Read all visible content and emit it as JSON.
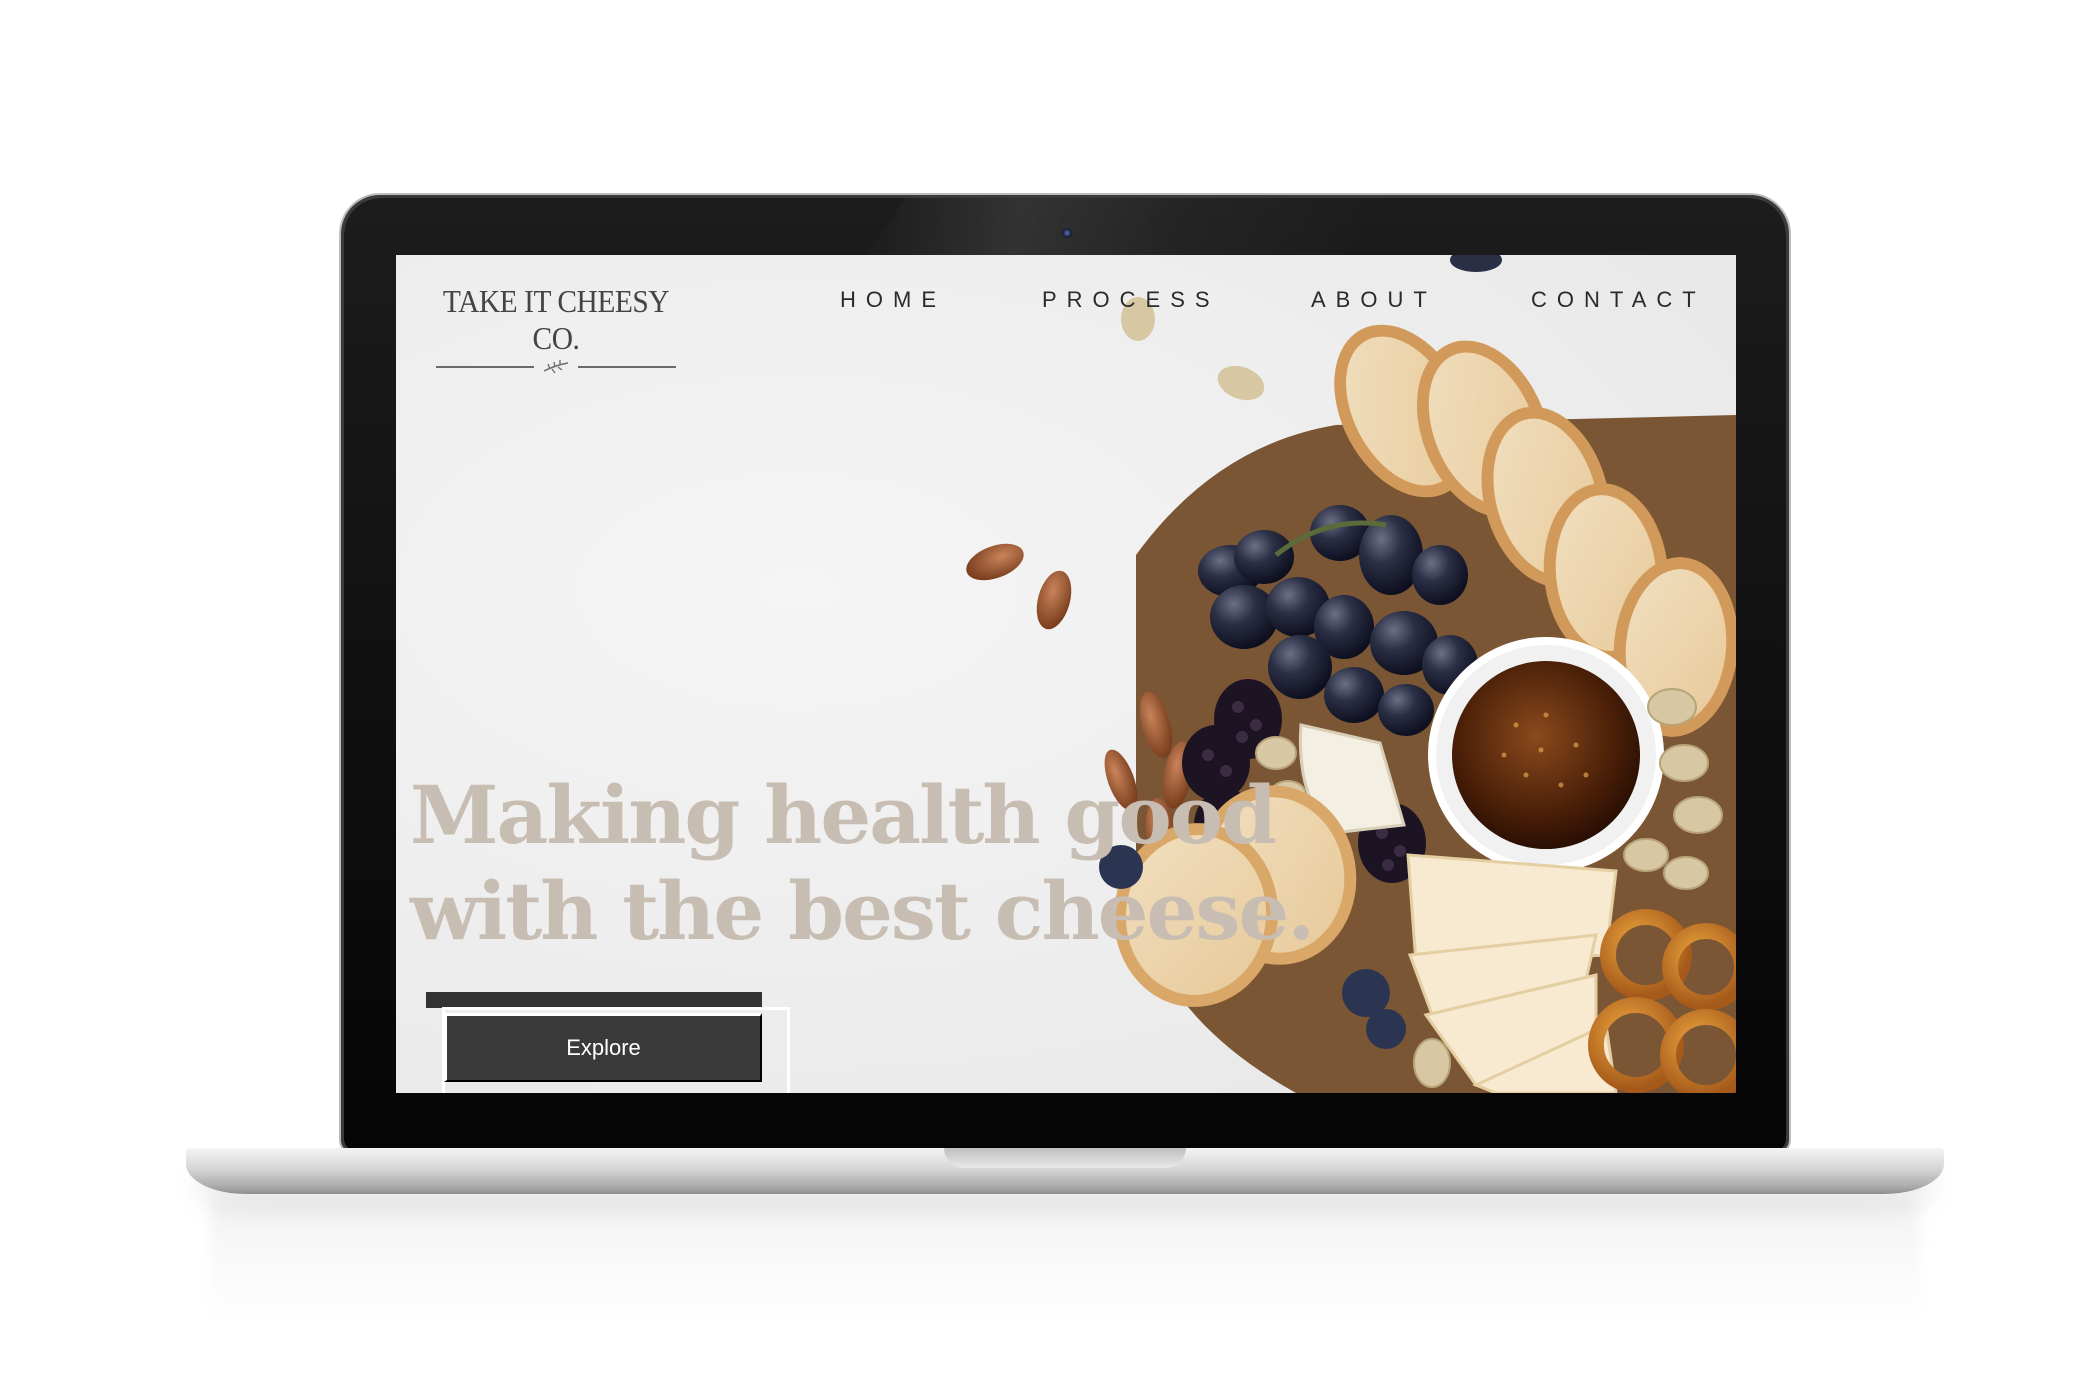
{
  "brand": {
    "name": "TAKE IT CHEESY CO."
  },
  "nav": {
    "items": [
      {
        "label": "HOME"
      },
      {
        "label": "PROCESS"
      },
      {
        "label": "ABOUT"
      },
      {
        "label": "CONTACT"
      }
    ]
  },
  "hero": {
    "headline_line1": "Making health good",
    "headline_line2": "with the best cheese.",
    "cta_label": "Explore"
  },
  "icons": {
    "logo_ornament": "sprig-icon",
    "camera": "webcam-icon"
  },
  "colors": {
    "headline": "#c8bdb2",
    "button_bg": "#333333",
    "nav_text": "#2a2a2a",
    "page_bg": "#ebebeb"
  }
}
